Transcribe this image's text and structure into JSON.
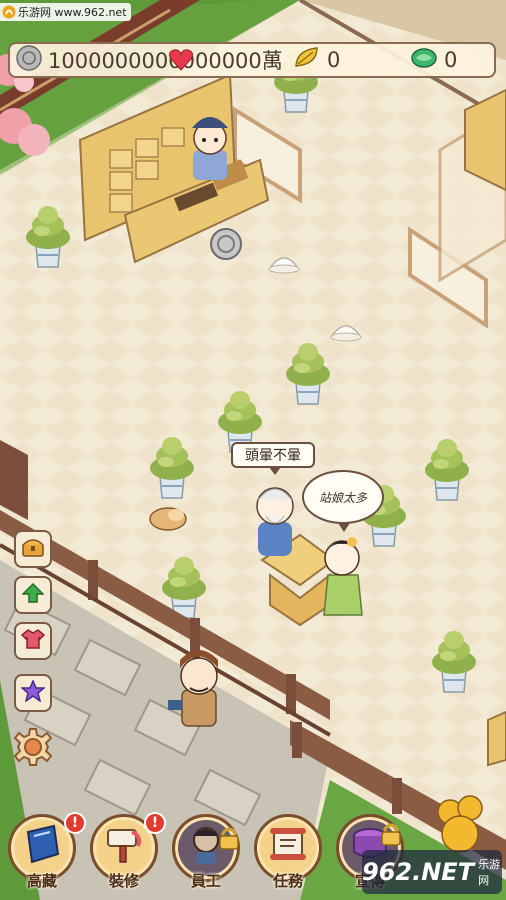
{
  "watermark": {
    "text": "乐游网 www.962.net"
  },
  "resources": {
    "silver": {
      "icon": "silver-coin-icon",
      "value": "1000000000000000萬"
    },
    "gold_leaf": {
      "icon": "gold-leaf-icon",
      "value": "0"
    },
    "jade": {
      "icon": "jade-icon",
      "value": "0"
    }
  },
  "speech": {
    "elder": "頭暈不暈",
    "lady": "站娘太多"
  },
  "side_buttons": [
    {
      "name": "chest",
      "icon": "treasure-chest-icon"
    },
    {
      "name": "upgrade",
      "icon": "green-arrow-up-icon"
    },
    {
      "name": "clothing",
      "icon": "clothes-icon"
    },
    {
      "name": "favorite",
      "icon": "purple-star-icon"
    },
    {
      "name": "settings",
      "icon": "gear-icon"
    }
  ],
  "bottom_nav": [
    {
      "label": "裝修",
      "icon": "brush-icon",
      "badge": "!"
    },
    {
      "label": "員工",
      "icon": "staff-icon",
      "locked": true
    },
    {
      "label": "任務",
      "icon": "scroll-icon"
    },
    {
      "label": "宣傳",
      "icon": "drum-icon",
      "locked": true
    }
  ],
  "colors": {
    "floor": "#f3ead6",
    "grass": "#5f9a3a",
    "wood": "#e9c46f",
    "frame": "#8a6a52",
    "badge": "#e23c2e"
  },
  "corner_logo": {
    "text": "962.NET",
    "sub": "乐游网"
  }
}
